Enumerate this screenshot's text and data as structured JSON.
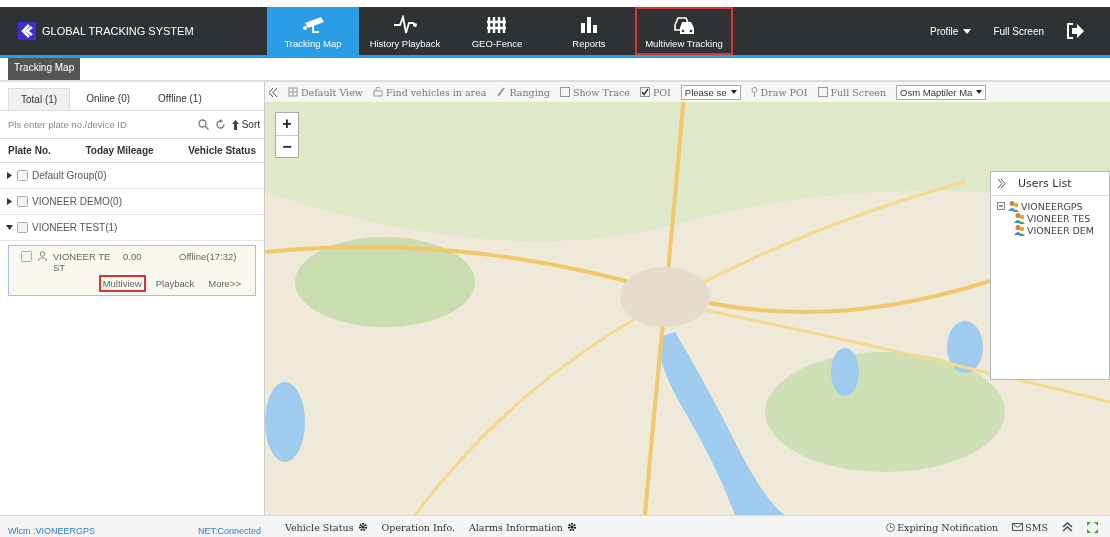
{
  "app": {
    "title": "GLOBAL TRACKING SYSTEM"
  },
  "nav": [
    {
      "label": "Tracking Map",
      "kind": "camera",
      "selected": true,
      "highlighted": false
    },
    {
      "label": "History Playback",
      "kind": "pulse",
      "selected": false,
      "highlighted": false
    },
    {
      "label": "GEO-Fence",
      "kind": "fence",
      "selected": false,
      "highlighted": false
    },
    {
      "label": "Reports",
      "kind": "bars",
      "selected": false,
      "highlighted": false
    },
    {
      "label": "Multiview Tracking",
      "kind": "cars",
      "selected": false,
      "highlighted": true
    }
  ],
  "header_links": [
    {
      "label": "Profile",
      "kind": "dropdown"
    },
    {
      "label": "Full Screen",
      "kind": "link"
    }
  ],
  "page_tab": "Tracking Map",
  "vehicle_tabs": [
    {
      "label": "Total (1)",
      "selected": true
    },
    {
      "label": "Online (0)",
      "selected": false
    },
    {
      "label": "Offline (1)",
      "selected": false
    }
  ],
  "search": {
    "placeholder": "Pls enter plate no./device ID"
  },
  "sort_label": "Sort",
  "columns": [
    "Plate No.",
    "Today Mileage",
    "Vehicle Status"
  ],
  "groups": [
    {
      "name": "Default Group",
      "count": "(0)",
      "expanded": false,
      "checked": false
    },
    {
      "name": "VIONEER DEMO",
      "count": "(0)",
      "expanded": false,
      "checked": false
    },
    {
      "name": "VIONEER TEST",
      "count": "(1)",
      "expanded": true,
      "checked": false,
      "children": [
        {
          "plate": "VIONEER TEST",
          "mileage": "0.00",
          "status": "Offline(17:32)",
          "checked": false,
          "actions": [
            {
              "label": "Multiview",
              "highlighted": true
            },
            {
              "label": "Playback",
              "highlighted": false
            },
            {
              "label": "More>>",
              "highlighted": false
            }
          ]
        }
      ]
    }
  ],
  "map_toolbar": [
    {
      "kind": "button",
      "label": "Default View"
    },
    {
      "kind": "button",
      "label": "Find vehicles in area"
    },
    {
      "kind": "button",
      "label": "Ranging"
    },
    {
      "kind": "checkbox",
      "label": "Show Trace",
      "checked": false
    },
    {
      "kind": "checkbox",
      "label": "POI",
      "checked": true
    },
    {
      "kind": "select",
      "label": "Please se"
    },
    {
      "kind": "button",
      "label": "Draw POI"
    },
    {
      "kind": "checkbox",
      "label": "Full Screen",
      "checked": false
    },
    {
      "kind": "select",
      "label": "Osm Maptiler Ma"
    }
  ],
  "zoom": [
    "+",
    "−"
  ],
  "users_list": {
    "title": "Users List",
    "root": {
      "name": "VIONEERGPS",
      "expanded": true,
      "children": [
        {
          "name": "VIONEER TES"
        },
        {
          "name": "VIONEER DEM"
        }
      ]
    }
  },
  "status_bar": {
    "user": "Wlcm :VIONEERGPS",
    "net": "NET:Connected"
  },
  "bottom_tabs": [
    {
      "label": "Vehicle Status",
      "gear": true
    },
    {
      "label": "Operation Info.",
      "gear": false
    },
    {
      "label": "Alarms Information",
      "gear": true
    }
  ],
  "bottom_right": [
    {
      "label": "Expiring Notification",
      "kind": "clock"
    },
    {
      "label": "SMS",
      "kind": "mail"
    }
  ]
}
